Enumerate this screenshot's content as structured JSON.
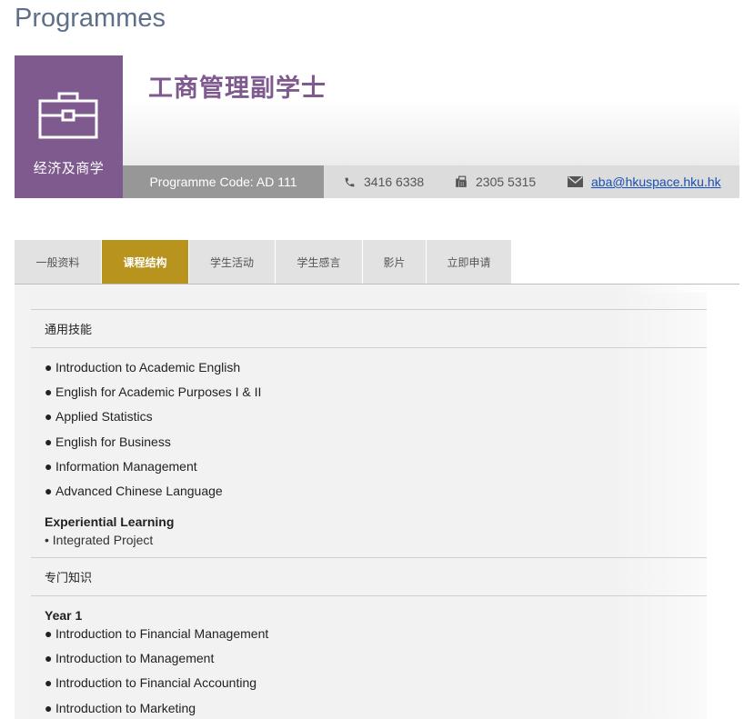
{
  "page": {
    "heading": "Programmes"
  },
  "programme": {
    "category": "经济及商学",
    "title": "工商管理副学士",
    "code_label": "Programme Code: AD 111",
    "phone": "3416 6338",
    "fax": "2305 5315",
    "email": "aba@hkuspace.hku.hk"
  },
  "tabs": [
    {
      "label": "一般资料",
      "active": false
    },
    {
      "label": "课程结构",
      "active": true
    },
    {
      "label": "学生活动",
      "active": false
    },
    {
      "label": "学生感言",
      "active": false
    },
    {
      "label": "影片",
      "active": false
    },
    {
      "label": "立即申请",
      "active": false
    }
  ],
  "structure": {
    "general_skills": {
      "heading": "通用技能",
      "items": [
        "Introduction to Academic English",
        "English for Academic Purposes I & II",
        "Applied Statistics",
        "English for Business",
        "Information Management",
        "Advanced Chinese Language"
      ],
      "experiential": {
        "heading": "Experiential Learning",
        "item": "• Integrated Project"
      }
    },
    "specialised": {
      "heading": "专门知识",
      "year1": {
        "heading": "Year 1",
        "items": [
          "Introduction to Financial Management",
          "Introduction to Management",
          "Introduction to Financial Accounting",
          "Introduction to Marketing"
        ]
      }
    }
  },
  "colors": {
    "category_purple": "#7f5a8f",
    "active_tab_gold": "#b8941e",
    "code_grey": "#979797",
    "heading_slate": "#5e7089"
  }
}
